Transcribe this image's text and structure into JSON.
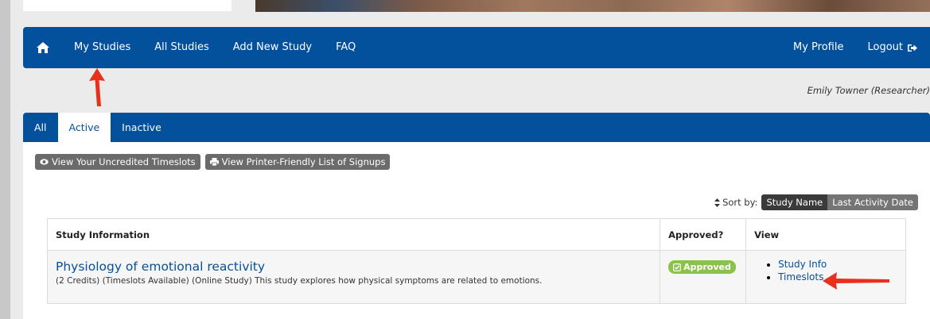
{
  "nav": {
    "home_icon": "home-icon",
    "items": [
      {
        "label": "My Studies"
      },
      {
        "label": "All Studies"
      },
      {
        "label": "Add New Study"
      },
      {
        "label": "FAQ"
      }
    ],
    "right_items": [
      {
        "label": "My Profile"
      },
      {
        "label": "Logout"
      }
    ]
  },
  "user": {
    "display": "Emily Towner (Researcher)"
  },
  "tabs": [
    {
      "label": "All"
    },
    {
      "label": "Active"
    },
    {
      "label": "Inactive"
    }
  ],
  "actions": {
    "uncredited_label": "View Your Uncredited Timeslots",
    "printer_label": "View Printer-Friendly List of Signups"
  },
  "sort": {
    "label": "Sort by:",
    "options": [
      "Study Name",
      "Last Activity Date"
    ]
  },
  "table": {
    "headers": [
      "Study Information",
      "Approved?",
      "View"
    ],
    "rows": [
      {
        "title": "Physiology of emotional reactivity",
        "description": "(2 Credits) (Timeslots Available) (Online Study) This study explores how physical symptoms are related to emotions.",
        "status": "Approved",
        "links": [
          "Study Info",
          "Timeslots"
        ]
      }
    ]
  },
  "colors": {
    "primary": "#03509d",
    "approved": "#8bc34a",
    "annotation_arrow": "#e8301c"
  }
}
